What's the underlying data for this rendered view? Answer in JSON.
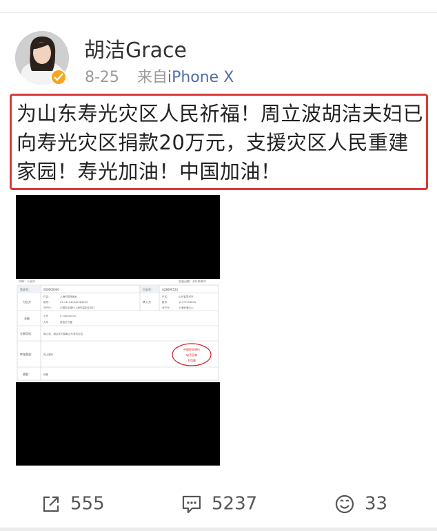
{
  "user": {
    "name": "胡洁Grace"
  },
  "meta": {
    "date": "8-25",
    "from": "来自",
    "source": "iPhone X"
  },
  "post": {
    "text": "为山东寿光灾区人民祈福！周立波胡洁夫妇已向寿光灾区捐款20万元，支援灾区人民重建家园！寿光加油！中国加油！"
  },
  "receipt": {
    "header_left": "币种：人民币",
    "header_right": "交易日期：20180807",
    "row1_label": "凭证号：",
    "row1_value": "000000000",
    "row1_right_label": "日志号：",
    "row1_right_value": "A28690523",
    "payer_label": "付出方",
    "payer_name_key": "户名：",
    "payer_name": "上海市周萍鑫业",
    "payer_acct_key": "账号：",
    "payer_acct": "03-131530040984363",
    "payer_bank_key": "开户行：",
    "payer_bank": "中国农业银行上海市嘉定区支行",
    "payee_label": "转入方",
    "payee_name": "山东省寿光市",
    "payee_acct": "15771593809",
    "payee_bank": "上海淮海中心",
    "amount_label": "金额",
    "amount_small_key": "小写",
    "amount_small": "¥ 200000.00",
    "amount_big_key": "大写",
    "amount_big": "贰拾万元整",
    "purpose_label": "交易用途：",
    "purpose": "周立波、胡洁夫妇捐款山东寿光灾区",
    "channel_label": "转账渠道：",
    "channel": "网上银行",
    "note_label": "摘要：",
    "note": "转账",
    "stamp_line1": "中国农业银行",
    "stamp_line2": "电子回单",
    "stamp_line3": "专用章"
  },
  "actions": {
    "reposts": "555",
    "comments": "5237",
    "likes": "33"
  },
  "icons": [
    "verified-badge-icon",
    "repost-icon",
    "comment-icon",
    "like-icon"
  ],
  "colors": {
    "highlight_border": "#d83a3a",
    "verified": "#f5a623",
    "source_link": "#4f6fa8"
  }
}
